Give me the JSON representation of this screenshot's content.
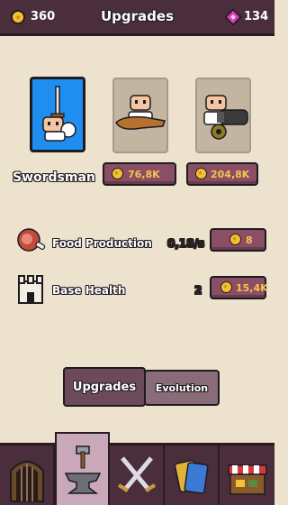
{
  "header": {
    "coins": "360",
    "title": "Upgrades",
    "gems": "134"
  },
  "units": [
    {
      "name": "Swordsman",
      "state": "selected",
      "icon": "swordsman-icon"
    },
    {
      "name": "",
      "state": "locked",
      "icon": "club-warrior-icon",
      "price": "76,8K"
    },
    {
      "name": "",
      "state": "locked",
      "icon": "cannon-gunner-icon",
      "price": "204,8K"
    }
  ],
  "selected_unit_label": "Swordsman",
  "stats": [
    {
      "label": "Food Production",
      "value": "0,18/s",
      "price": "8",
      "icon": "meat-icon"
    },
    {
      "label": "Base Health",
      "value": "2",
      "price": "15,4K",
      "icon": "castle-tower-icon"
    }
  ],
  "tabs": {
    "active": "Upgrades",
    "inactive": "Evolution"
  },
  "bottom_nav": [
    {
      "icon": "gate-icon"
    },
    {
      "icon": "anvil-hammer-icon",
      "active": true
    },
    {
      "icon": "crossed-swords-icon"
    },
    {
      "icon": "cards-icon"
    },
    {
      "icon": "shop-icon"
    }
  ],
  "colors": {
    "background": "#ece2cd",
    "topbar": "#4a2e3c",
    "selected_card": "#1e8ff0",
    "price_button": "#8a4f65",
    "price_text": "#f7c34a",
    "gem": "#d43fc3",
    "coin": "#f2c232"
  }
}
